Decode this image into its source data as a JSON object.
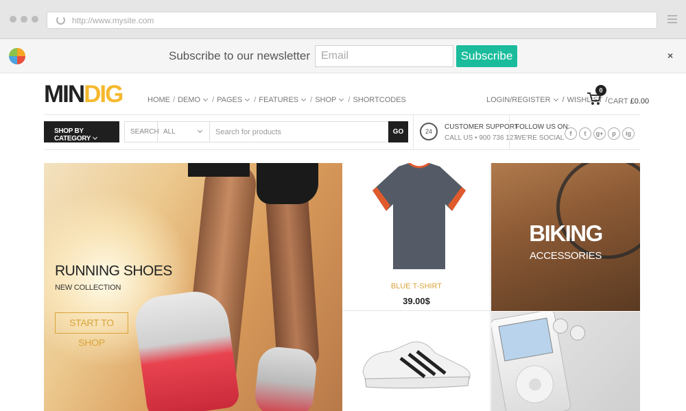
{
  "browser": {
    "url": "http://www.mysite.com"
  },
  "newsletter": {
    "text": "Subscribe to our newsletter",
    "email_placeholder": "Email",
    "subscribe_label": "Subscribe",
    "close": "×"
  },
  "header": {
    "logo_part1": "MIN",
    "logo_part2": "DIG",
    "nav": [
      "HOME",
      "DEMO",
      "PAGES",
      "FEATURES",
      "SHOP",
      "SHORTCODES"
    ],
    "login": "LOGIN/REGISTER",
    "wishlist": "WISHLIST",
    "cart_count": "0",
    "cart_label": "CART",
    "cart_total": "£0.00"
  },
  "search": {
    "category_button": "SHOP BY CATEGORY",
    "label": "SEARCH",
    "select_value": "ALL",
    "placeholder": "Search for products",
    "go": "GO"
  },
  "support": {
    "icon_text": "24",
    "title": "CUSTOMER SUPPORT",
    "phone": "CALL US • 900 736 127"
  },
  "follow": {
    "title": "FOLLOW US ON:",
    "sub": "WE'RE SOCIAL",
    "icons": [
      "f",
      "t",
      "g+",
      "p",
      "ig"
    ]
  },
  "hero": {
    "title": "RUNNING SHOES",
    "subtitle": "NEW COLLECTION",
    "button": "START TO SHOP"
  },
  "product": {
    "name": "BLUE T-SHIRT",
    "price": "39.00$"
  },
  "biking": {
    "title": "BIKING",
    "subtitle": "ACCESSORIES"
  },
  "colors": {
    "accent": "#f5b82e",
    "subscribe": "#1abc9c",
    "dark": "#1f1f1f"
  }
}
